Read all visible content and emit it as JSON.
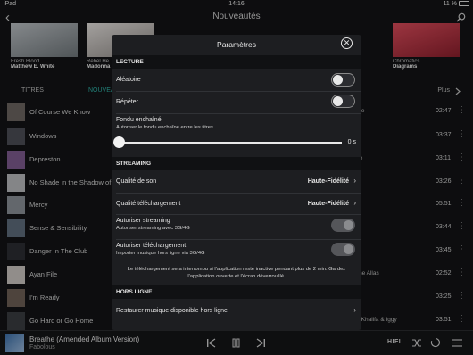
{
  "status": {
    "device": "iPad",
    "time": "14:16",
    "battery": "11 %"
  },
  "header": {
    "title": "Nouveautés",
    "back": "‹"
  },
  "albums": [
    {
      "title": "Fresh Blood",
      "artist": "Matthew E. White",
      "color": "#9aa3a8"
    },
    {
      "title": "Rebel He",
      "artist": "Madonna",
      "color": "#c7c2bf"
    },
    {
      "title": "Chromatics",
      "artist": "Diagrams",
      "color": "#c23a4a"
    }
  ],
  "list": {
    "section": "TITRES",
    "tab": "NOUVEA",
    "more": "Plus"
  },
  "tracks": [
    {
      "name": "Of Course We Know",
      "artist": "use",
      "duration": "02:47",
      "color": "#6b6560"
    },
    {
      "name": "Windows",
      "artist": "N",
      "duration": "03:37",
      "color": "#4b4d55"
    },
    {
      "name": "Depreston",
      "artist": "ise",
      "duration": "03:11",
      "color": "#7d5b8e"
    },
    {
      "name": "No Shade in the Shadow of",
      "artist": "",
      "duration": "03:26",
      "color": "#b7b9bb"
    },
    {
      "name": "Mercy",
      "artist": "",
      "duration": "05:51",
      "color": "#8a8f96"
    },
    {
      "name": "Sense & Sensibility",
      "artist": "",
      "duration": "03:44",
      "color": "#5d6b7a"
    },
    {
      "name": "Danger In The Club",
      "artist": "",
      "duration": "03:45",
      "color": "#2b2d33"
    },
    {
      "name": "Ayan File",
      "artist": "The Allas",
      "duration": "02:52",
      "color": "#c9c4c0"
    },
    {
      "name": "I'm Ready",
      "artist": "",
      "duration": "03:25",
      "color": "#6d5f55"
    },
    {
      "name": "Go Hard or Go Home",
      "artist": "Wiz Khalifa & Iggy",
      "duration": "03:51",
      "color": "#3a3c40"
    }
  ],
  "player": {
    "song": "Breathe (Amended Album Version)",
    "artist": "Fabolous",
    "hifi": "HIFI"
  },
  "modal": {
    "title": "Paramètres",
    "lecture": {
      "heading": "LECTURE",
      "shuffle": "Aléatoire",
      "repeat": "Répéter",
      "crossfade": "Fondu enchaîné",
      "crossfade_sub": "Autoriser le fondu enchaîné entre les titres",
      "crossfade_value": "0 s",
      "shuffle_on": false,
      "repeat_on": false
    },
    "streaming": {
      "heading": "STREAMING",
      "quality": "Qualité de son",
      "quality_value": "Haute-Fidélité",
      "dl_quality": "Qualité téléchargement",
      "dl_quality_value": "Haute-Fidélité",
      "allow_streaming": "Autoriser streaming",
      "allow_streaming_sub": "Autoriser streaming avec 3G/4G",
      "allow_download": "Autoriser téléchargement",
      "allow_download_sub": "Importer musique hors ligne via 3G/4G",
      "note": "Le téléchargement sera interrompu si l'application reste inactive pendant plus de 2 min. Gardez l'application ouverte et l'écran déverrouillé."
    },
    "offline": {
      "heading": "HORS LIGNE",
      "restore": "Restaurer musique disponible hors ligne"
    }
  }
}
